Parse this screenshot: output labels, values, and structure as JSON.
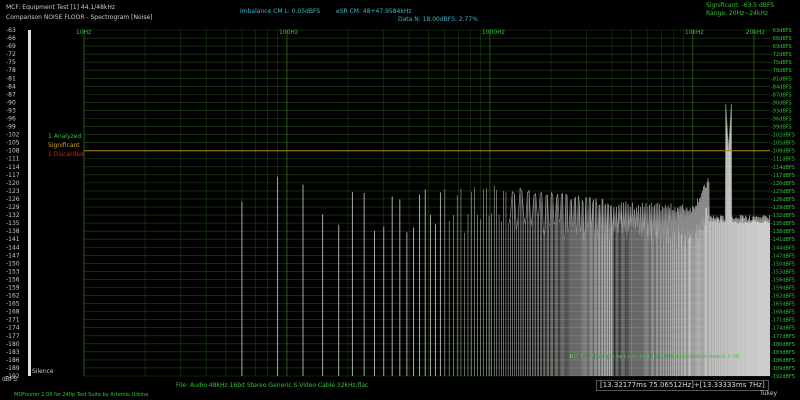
{
  "header": {
    "line1": "MCF: Equipment Test [1] 44.1/48kHz",
    "line2": "Comparison NOISE FLOOR - Spectrogram [Noise]",
    "imbalance": "Imbalance CM L: 0.05dBFS",
    "esr": "eSR CM: 48+47.9584kHz",
    "data_line": "Data N: 18.00dBFS: 2.77%",
    "significant": "Significant: -63.5 dBFS",
    "range": "Range: 20Hz~24kHz"
  },
  "freq_markers": [
    "10Hz",
    "100Hz",
    "1000Hz",
    "10kHz",
    "20kHz"
  ],
  "left_scale": {
    "ticks": [
      -63,
      -66,
      -69,
      -72,
      -75,
      -78,
      -81,
      -84,
      -87,
      -90,
      -93,
      -96,
      -99,
      -102,
      -105,
      -108,
      -111,
      -114,
      -117,
      -120,
      -123,
      -126,
      -129,
      -132,
      -135,
      -138,
      -141,
      -144,
      -147,
      -150,
      -153,
      -156,
      -159,
      -162,
      -165,
      -168,
      -171,
      -174,
      -177,
      -180,
      -183,
      -186,
      -189,
      -192
    ],
    "unit": "dBFS",
    "silence_label": "Silence"
  },
  "right_scale": {
    "unit": "dBFS"
  },
  "legend": {
    "analyzed": "1 Analyzed",
    "significant": "Significant",
    "discarded": "1 Discarded"
  },
  "note": "NOTE: CM sample rate calculated +1.0014   Adjusted to match: (~0)",
  "file_info": "File: Audio    48kHz 16bit Stereo Generic S-Video Cable 32kHz.flac",
  "coordinates": "[13.32177ms 75.06512Hz]+[13.33333ms 7Hz]",
  "window": "Tukey",
  "footer_credit": "MDFourier 1.06 for 240p Test Suite by Artemio Urbina",
  "colors": {
    "grid": "#1f4a12",
    "green_text": "#33c433",
    "cyan_text": "#3fb6c9",
    "significant_line": "#a88a10",
    "bars": "#d0d0d0"
  },
  "chart_data": {
    "type": "bar",
    "xscale": "log",
    "xlim": [
      10,
      24000
    ],
    "ylim": [
      -192,
      -63
    ],
    "significant_level": -108,
    "peaks": [
      {
        "x": 60,
        "y": -117
      },
      {
        "x": 120,
        "y": -121
      },
      {
        "x": 180,
        "y": -126
      },
      {
        "x": 240,
        "y": -124
      },
      {
        "x": 360,
        "y": -127
      },
      {
        "x": 480,
        "y": -124
      },
      {
        "x": 600,
        "y": -124
      },
      {
        "x": 720,
        "y": -125
      },
      {
        "x": 960,
        "y": -124
      },
      {
        "x": 1200,
        "y": -124
      },
      {
        "x": 1500,
        "y": -125
      },
      {
        "x": 2000,
        "y": -126
      },
      {
        "x": 3000,
        "y": -128
      },
      {
        "x": 5000,
        "y": -130
      },
      {
        "x": 10000,
        "y": -131
      },
      {
        "x": 15000,
        "y": -108
      }
    ]
  }
}
